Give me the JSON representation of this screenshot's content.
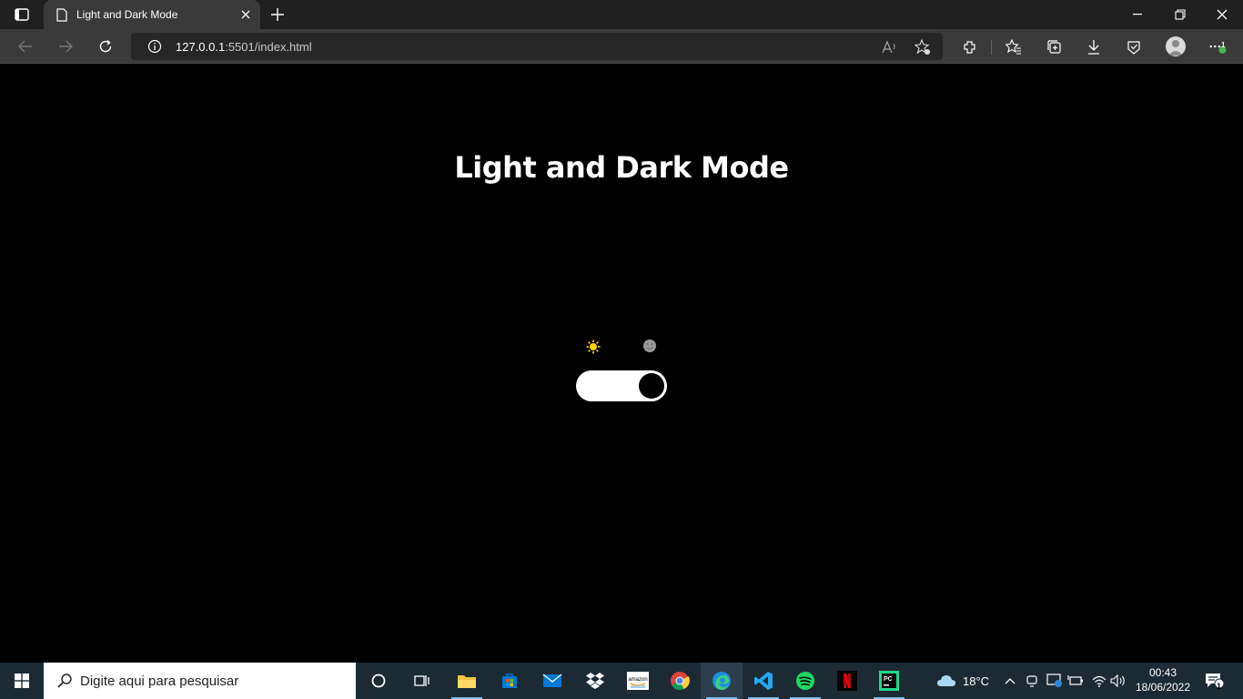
{
  "browser": {
    "tab_title": "Light and Dark Mode",
    "url_host": "127.0.0.1",
    "url_rest": ":5501/index.html",
    "notification_badge": "1"
  },
  "page": {
    "title": "Light and Dark Mode",
    "toggle_state": "dark",
    "sun_icon": "sun-icon",
    "moon_icon": "moon-icon",
    "colors": {
      "background": "#000000",
      "text": "#ffffff",
      "sun": "#ffd700"
    }
  },
  "taskbar": {
    "search_placeholder": "Digite aqui para pesquisar",
    "weather": "18°C",
    "time": "00:43",
    "date": "18/06/2022",
    "notification_count": "1"
  }
}
